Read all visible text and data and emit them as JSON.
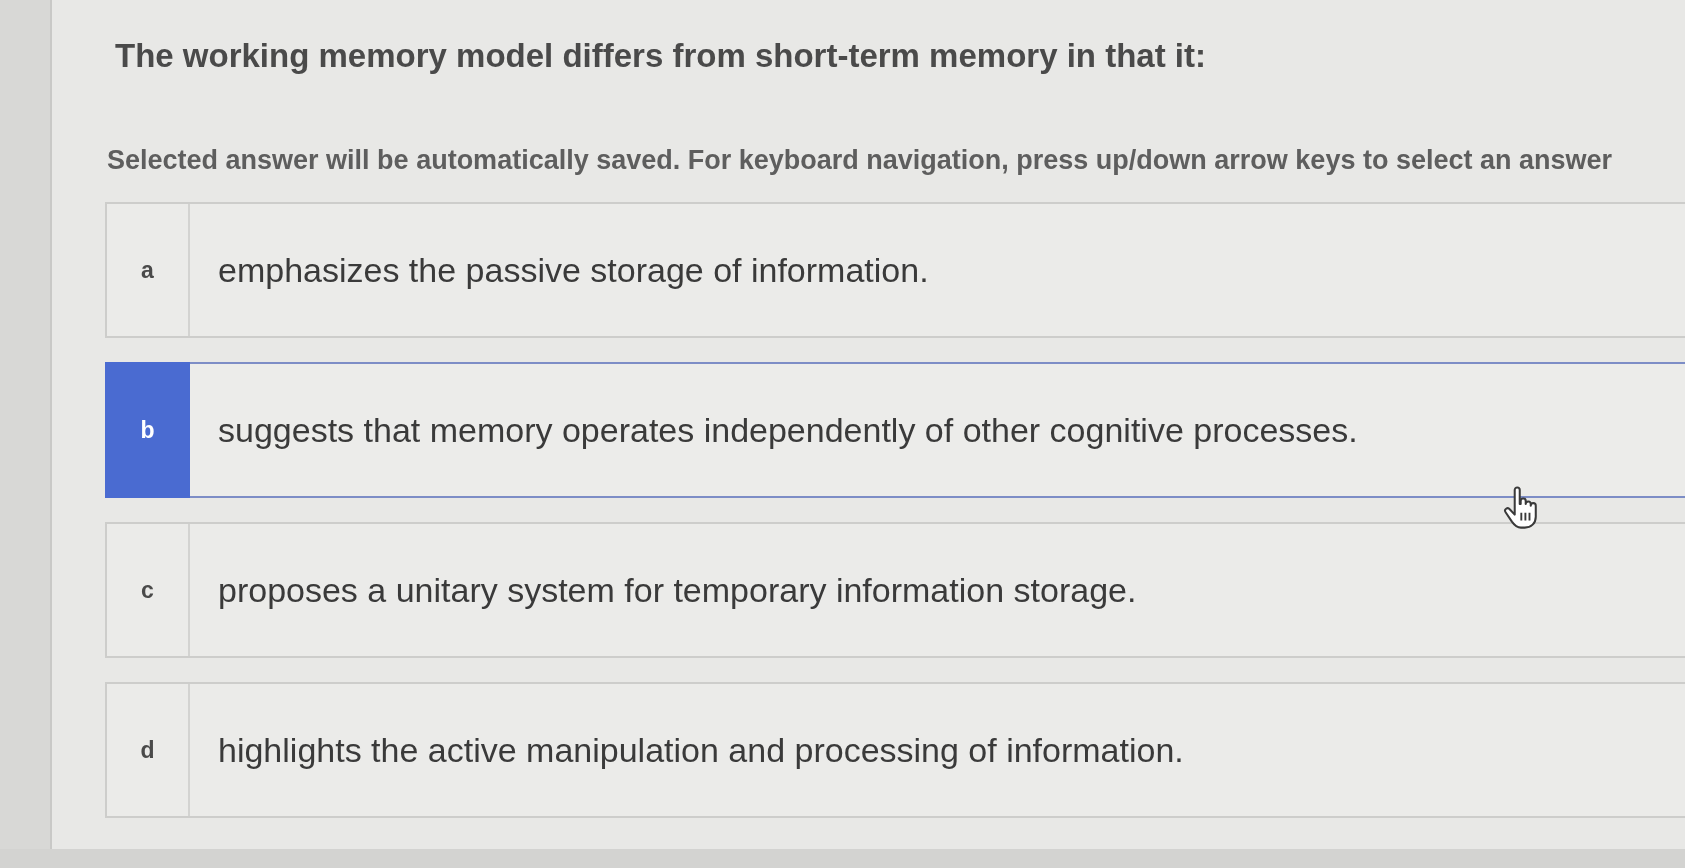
{
  "question": {
    "text": "The working memory model differs from short-term memory in that it:",
    "instructions": "Selected answer will be automatically saved. For keyboard navigation, press up/down arrow keys to select an answer"
  },
  "options": [
    {
      "letter": "a",
      "text": "emphasizes the passive storage of information.",
      "selected": false
    },
    {
      "letter": "b",
      "text": "suggests that memory operates independently of other cognitive processes.",
      "selected": true
    },
    {
      "letter": "c",
      "text": "proposes a unitary system for temporary information storage.",
      "selected": false
    },
    {
      "letter": "d",
      "text": "highlights the active manipulation and processing of information.",
      "selected": false
    }
  ]
}
